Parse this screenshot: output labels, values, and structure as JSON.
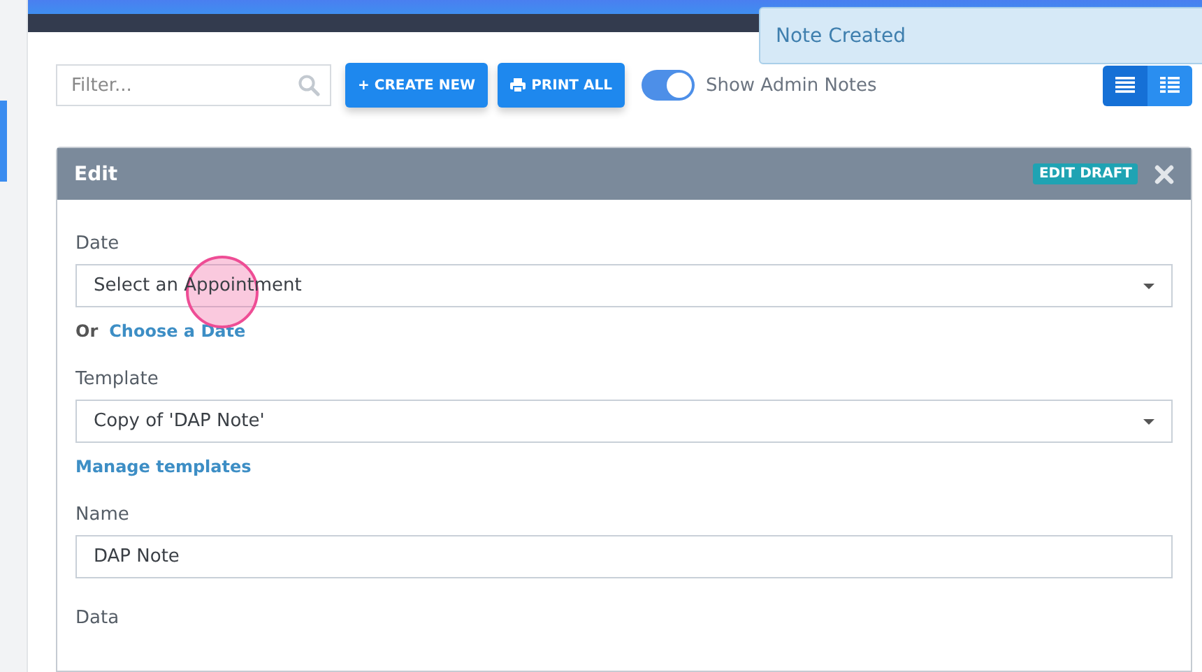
{
  "toast": {
    "text": "Note Created"
  },
  "toolbar": {
    "filter": {
      "placeholder": "Filter..."
    },
    "create_button": "+ CREATE NEW",
    "print_button": "PRINT ALL",
    "admin_toggle": {
      "label": "Show Admin Notes",
      "on": true
    },
    "view_buttons": [
      {
        "kind": "list",
        "selected": true
      },
      {
        "kind": "grid",
        "selected": false
      }
    ]
  },
  "panel": {
    "title": "Edit",
    "badge": "EDIT DRAFT",
    "fields": [
      {
        "kind": "select",
        "label": "Date",
        "value": "Select an Appointment",
        "helper": {
          "prefix": "Or",
          "link": "Choose a Date"
        }
      },
      {
        "kind": "select",
        "label": "Template",
        "value": "Copy of 'DAP Note'",
        "helper": {
          "link": "Manage templates"
        }
      },
      {
        "kind": "text",
        "label": "Name",
        "value": "DAP Note"
      },
      {
        "kind": "label",
        "label": "Data"
      }
    ]
  }
}
